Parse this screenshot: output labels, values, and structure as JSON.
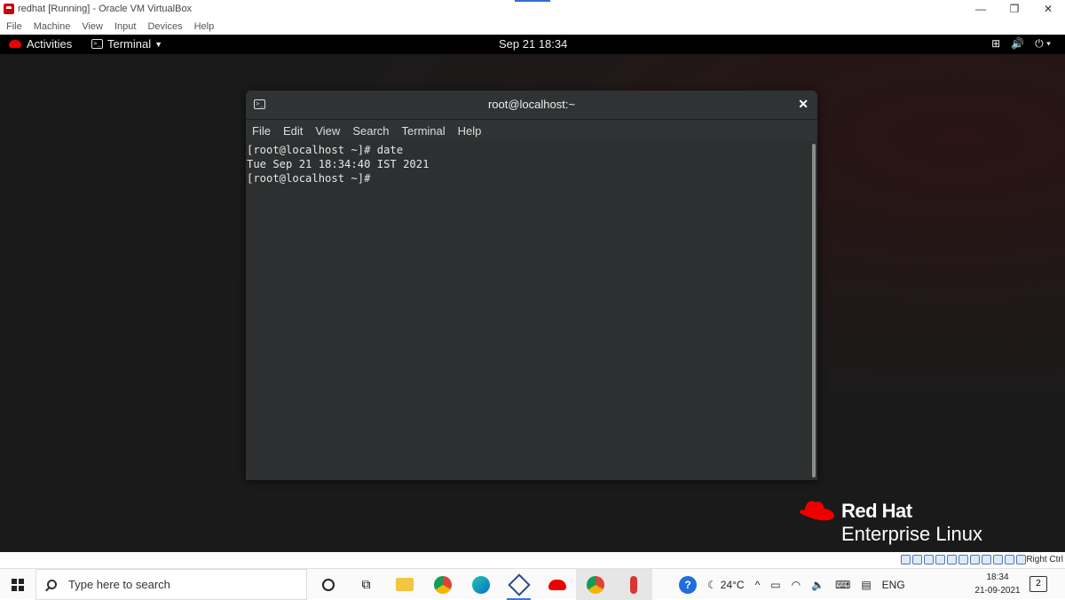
{
  "vbox": {
    "title": "redhat [Running] - Oracle VM VirtualBox",
    "menu": [
      "File",
      "Machine",
      "View",
      "Input",
      "Devices",
      "Help"
    ],
    "host_key": "Right Ctrl"
  },
  "gnome": {
    "activities": "Activities",
    "app_menu": "Terminal",
    "clock": "Sep 21  18:34"
  },
  "terminal": {
    "title": "root@localhost:~",
    "menu": [
      "File",
      "Edit",
      "View",
      "Search",
      "Terminal",
      "Help"
    ],
    "lines": [
      "[root@localhost ~]# date",
      "Tue Sep 21 18:34:40 IST 2021",
      "[root@localhost ~]#"
    ]
  },
  "branding": {
    "name": "Red Hat",
    "product": "Enterprise Linux",
    "accent_color": "#ee0000"
  },
  "taskbar": {
    "search_placeholder": "Type here to search",
    "weather": "24°C",
    "language": "ENG",
    "time": "18:34",
    "date": "21-09-2021",
    "notifications": "2"
  }
}
